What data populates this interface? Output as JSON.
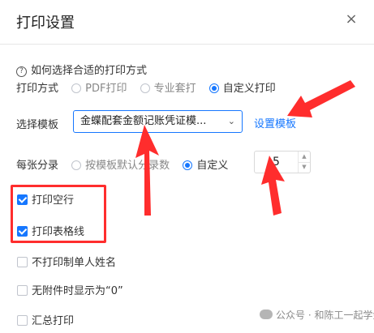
{
  "dialog": {
    "title": "打印设置",
    "close_symbol": "×"
  },
  "help": {
    "icon": "?",
    "text": "如何选择合适的打印方式"
  },
  "print_mode": {
    "label": "打印方式",
    "options": [
      "PDF打印",
      "专业套打",
      "自定义打印"
    ],
    "selected": "自定义打印"
  },
  "template": {
    "label": "选择模板",
    "value": "金蝶配套金额记账凭证模...",
    "settings_link": "设置模板"
  },
  "entries_per_page": {
    "label": "每张分录",
    "options": [
      "按模板默认分录数",
      "自定义"
    ],
    "selected": "自定义",
    "value": "5"
  },
  "checkboxes": [
    {
      "label": "打印空行",
      "checked": true
    },
    {
      "label": "打印表格线",
      "checked": true
    },
    {
      "label": "不打印制单人姓名",
      "checked": false
    },
    {
      "label": "无附件时显示为“0”",
      "checked": false
    },
    {
      "label": "汇总打印",
      "checked": false
    }
  ],
  "watermark": {
    "text": "公众号 · 和陈工一起学金蝶"
  },
  "colors": {
    "accent": "#1677ff",
    "annotation": "#ff2d2d"
  },
  "icons": {
    "close": "close-icon",
    "help": "question-circle-icon",
    "dropdown": "chevron-down-icon",
    "step_up": "caret-up-icon",
    "step_down": "caret-down-icon",
    "wechat": "wechat-icon"
  }
}
